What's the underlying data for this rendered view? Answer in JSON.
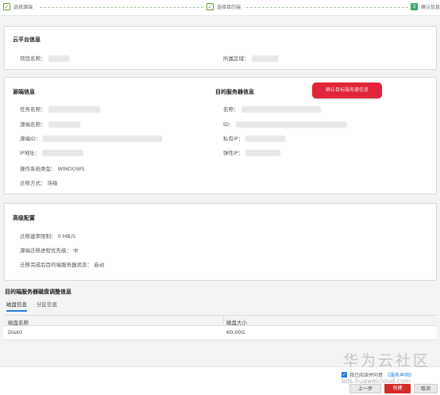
{
  "stepper": {
    "step1": "选择源端",
    "step2": "选择目的端",
    "step3": "确认信息",
    "step3_num": "3",
    "check": "✓"
  },
  "cloud": {
    "title": "云平台信息",
    "project_label": "项目名称：",
    "region_label": "所属区域："
  },
  "source": {
    "title": "源端信息",
    "task_label": "任务名称：",
    "source_name_label": "源端名称：",
    "source_id_label": "源端ID：",
    "ip_label": "IP地址：",
    "os_label": "操作系统类型：",
    "os_value": "WINDOWS",
    "mode_label": "迁移方式：",
    "mode_value": "块级"
  },
  "target": {
    "title": "目的服务器信息",
    "name_label": "名称：",
    "id_label": "ID：",
    "private_ip_label": "私有IP：",
    "eip_label": "弹性IP："
  },
  "badge": {
    "text": "确认目标服务器信息"
  },
  "advanced": {
    "title": "高级配置",
    "rate_label": "迁移速率限制：",
    "rate_value": "0 MB/S",
    "priority_label": "源端迁移进程优先级：",
    "priority_value": "中",
    "after_label": "迁移完成后目的端服务器状态：",
    "after_value": "启动"
  },
  "disk": {
    "title": "目的端服务器磁盘调整信息",
    "tabs": [
      "磁盘信息",
      "分区信息"
    ],
    "columns": [
      "磁盘名称",
      "磁盘大小"
    ],
    "rows": [
      {
        "name": "Disk0",
        "size": "60.00G"
      }
    ]
  },
  "footer": {
    "agree_text": "我已阅读并同意",
    "agree_link": "《服务声明》",
    "prev": "上一步",
    "create": "创建",
    "cancel": "取消"
  },
  "watermark": {
    "brand": "华为云社区",
    "url": "bbs.huaweicloud.com"
  },
  "colors": {
    "accent": "#2b7bd6",
    "danger": "#d52a2a",
    "step_done": "#6a9d3a",
    "step_active": "#3aa86b"
  }
}
